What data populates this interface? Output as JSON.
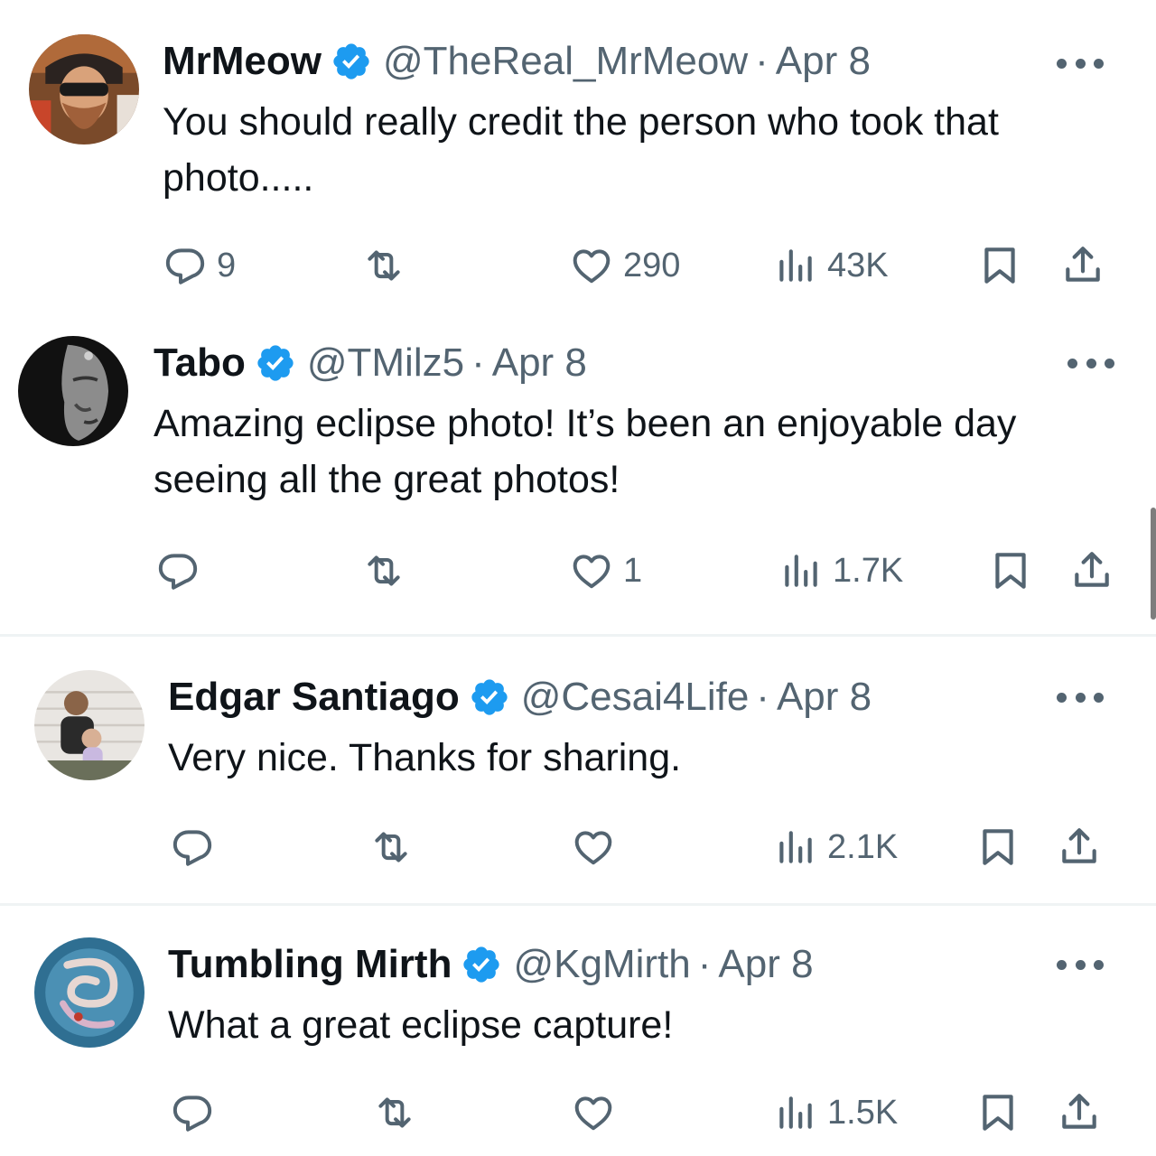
{
  "tweets": [
    {
      "name": "MrMeow",
      "handle": "@TheReal_MrMeow",
      "separator": "·",
      "date": "Apr 8",
      "text_lines": [
        "You should really credit the person who took that",
        "photo....."
      ],
      "replies": "9",
      "retweets": "",
      "likes": "290",
      "views": "43K",
      "avatar": "man-with-beard-and-goggles-avatar"
    },
    {
      "name": "Tabo",
      "handle": "@TMilz5",
      "separator": "·",
      "date": "Apr 8",
      "text_lines": [
        "Amazing eclipse photo!  It’s been an enjoyable day",
        "seeing all the great photos!"
      ],
      "replies": "",
      "retweets": "",
      "likes": "1",
      "views": "1.7K",
      "avatar": "buddha-face-avatar"
    },
    {
      "name": "Edgar Santiago",
      "handle": "@Cesai4Life",
      "separator": "·",
      "date": "Apr 8",
      "text_lines": [
        "Very nice. Thanks for sharing."
      ],
      "replies": "",
      "retweets": "",
      "likes": "",
      "views": "2.1K",
      "avatar": "father-and-child-avatar"
    },
    {
      "name": "Tumbling Mirth",
      "handle": "@KgMirth",
      "separator": "·",
      "date": "Apr 8",
      "text_lines": [
        "What a great eclipse capture!"
      ],
      "replies": "",
      "retweets": "",
      "likes": "",
      "views": "1.5K",
      "avatar": "abstract-swirl-avatar"
    }
  ],
  "colors": {
    "verified": "#1d9bf0",
    "text": "#0f1419",
    "secondary": "#536471",
    "divider": "#eff3f4"
  },
  "icons": [
    "verified-badge-icon",
    "more-options-icon",
    "reply-icon",
    "retweet-icon",
    "like-icon",
    "views-icon",
    "bookmark-icon",
    "share-icon"
  ]
}
